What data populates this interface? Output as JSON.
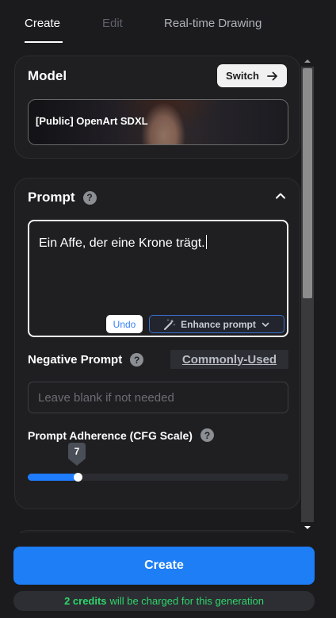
{
  "tabs": [
    {
      "label": "Create",
      "active": true
    },
    {
      "label": "Edit",
      "active": false
    },
    {
      "label": "Real-time Drawing",
      "active": false
    }
  ],
  "model": {
    "title": "Model",
    "switch_label": "Switch",
    "model_name": "[Public] OpenArt SDXL"
  },
  "prompt": {
    "title": "Prompt",
    "text": "Ein Affe, der eine Krone trägt.",
    "undo_label": "Undo",
    "enhance_label": "Enhance prompt"
  },
  "negative": {
    "title": "Negative Prompt",
    "commonly_used_label": "Commonly-Used",
    "placeholder": "Leave blank if not needed",
    "value": ""
  },
  "cfg": {
    "title": "Prompt Adherence (CFG Scale)",
    "value": "7",
    "fraction": 0.19
  },
  "footer": {
    "create_label": "Create",
    "credits_amount": "2 credits",
    "credits_text": "will be charged for this generation"
  },
  "colors": {
    "accent": "#1d7ef6",
    "credits": "#2fd66b"
  }
}
